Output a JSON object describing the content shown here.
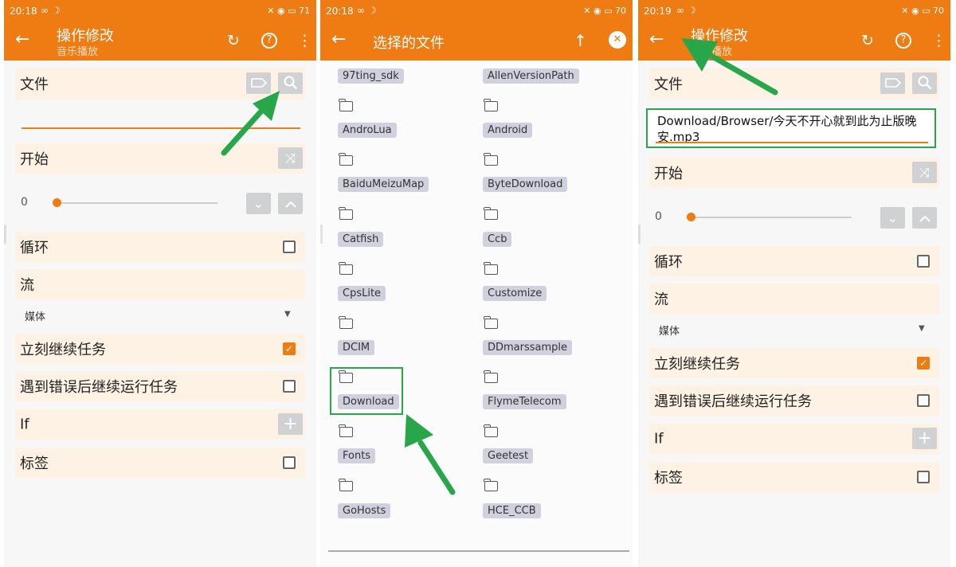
{
  "colors": {
    "accent": "#ee7c12",
    "highlight": "#27a64a",
    "chip_bg": "#d0d0de"
  },
  "status_left_icons": "∞ ☽",
  "status_right_icons": "✕ ◉ ▭",
  "panel1": {
    "time": "20:18",
    "battery": "71",
    "title": "操作修改",
    "subtitle": "音乐播放",
    "file_label": "文件",
    "start_label": "开始",
    "slider_value": "0",
    "loop_label": "循环",
    "stream_label": "流",
    "stream_value": "媒体",
    "continue_label": "立刻继续任务",
    "continue_on_error_label": "遇到错误后继续运行任务",
    "if_label": "If",
    "tag_label": "标签"
  },
  "panel2": {
    "time": "20:18",
    "battery": "70",
    "title": "选择的文件",
    "folders": [
      "97ting_sdk",
      "AllenVersionPath",
      "AndroLua",
      "Android",
      "BaiduMeizuMap",
      "ByteDownload",
      "Catfish",
      "Ccb",
      "CpsLite",
      "Customize",
      "DCIM",
      "DDmarssample",
      "Download",
      "FlymeTelecom",
      "Fonts",
      "Geetest",
      "GoHosts",
      "HCE_CCB"
    ]
  },
  "panel3": {
    "time": "20:19",
    "battery": "70",
    "title": "操作修改",
    "subtitle": "音乐播放",
    "file_label": "文件",
    "file_path": "Download/Browser/今天不开心就到此为止版晚安.mp3",
    "start_label": "开始",
    "slider_value": "0",
    "loop_label": "循环",
    "stream_label": "流",
    "stream_value": "媒体",
    "continue_label": "立刻继续任务",
    "continue_on_error_label": "遇到错误后继续运行任务",
    "if_label": "If",
    "tag_label": "标签"
  },
  "icons": {
    "back": "←",
    "refresh": "↻",
    "help": "?",
    "more": "⋮",
    "up": "↑",
    "close": "✕",
    "tag": "tag-icon",
    "search": "⌕",
    "shuffle": "⤨",
    "down": "⌄",
    "plus": "+"
  }
}
